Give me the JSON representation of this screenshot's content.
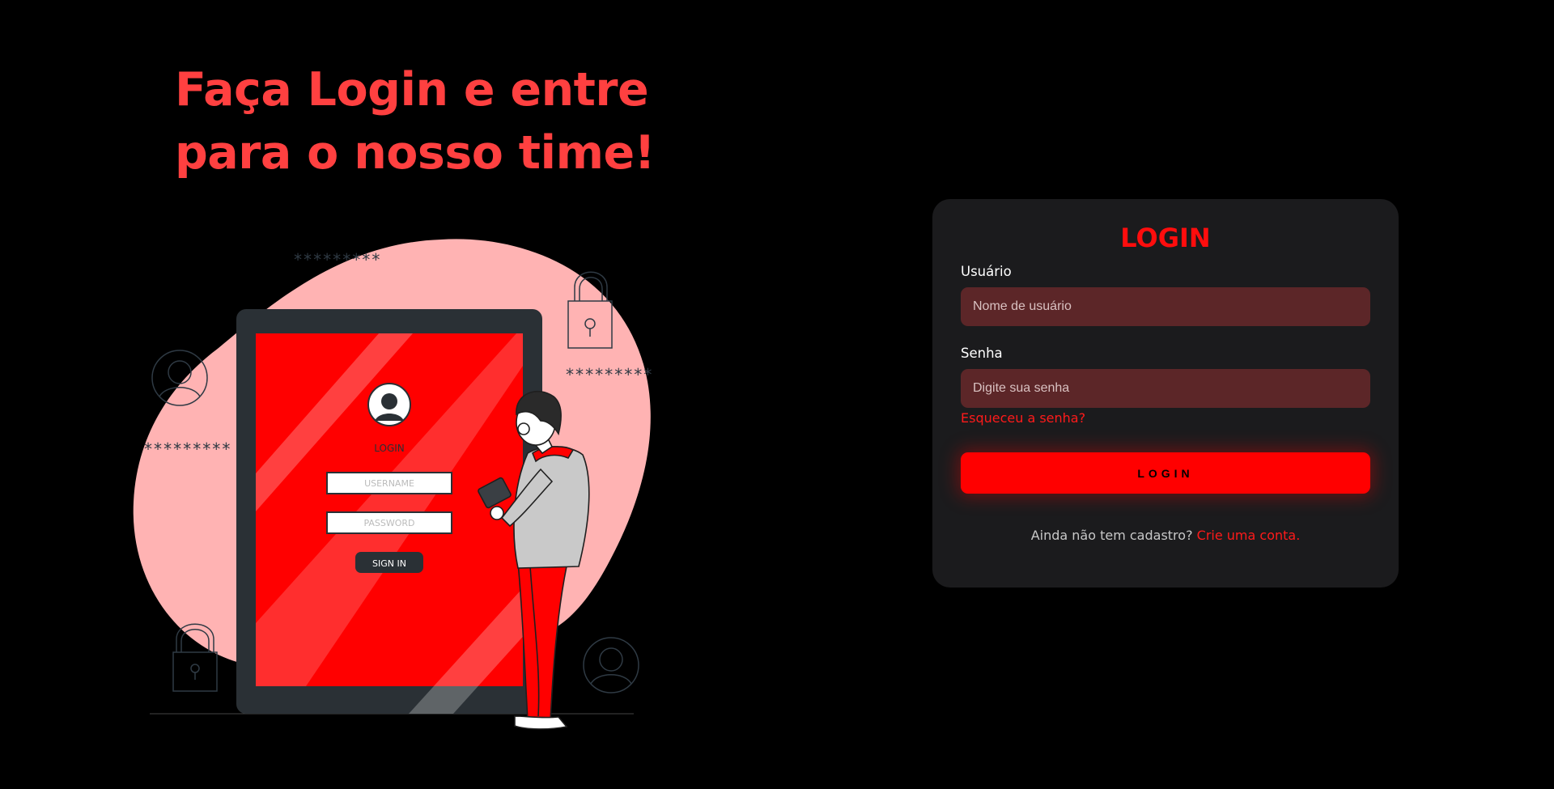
{
  "hero": {
    "title_line1": "Faça Login e entre",
    "title_line2": "para o nosso time!"
  },
  "illustration": {
    "password_mask": "*********",
    "phone_login_label": "LOGIN",
    "phone_username_placeholder": "USERNAME",
    "phone_password_placeholder": "PASSWORD",
    "phone_signin_label": "SIGN IN",
    "icons": [
      "padlock-icon",
      "user-avatar-icon",
      "person-with-tablet"
    ]
  },
  "login_form": {
    "title": "LOGIN",
    "username_label": "Usuário",
    "username_placeholder": "Nome de usuário",
    "password_label": "Senha",
    "password_placeholder": "Digite sua senha",
    "forgot_link": "Esqueceu a senha?",
    "submit_label": "LOGIN",
    "signup_question": "Ainda não tem cadastro?",
    "signup_link": "Crie uma conta."
  },
  "colors": {
    "background": "#000000",
    "accent": "#ff0000",
    "hero_text": "#ff4040",
    "card_bg": "#1b1b1d",
    "input_bg": "#5c2628",
    "blob": "#ffb3b3"
  }
}
